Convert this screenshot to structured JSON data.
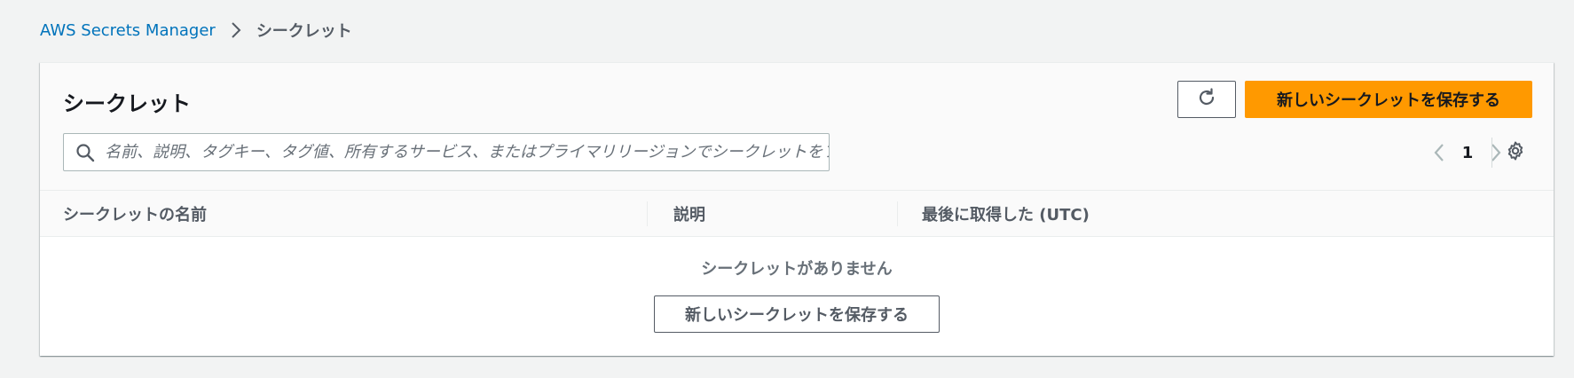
{
  "breadcrumb": {
    "root": "AWS Secrets Manager",
    "current": "シークレット"
  },
  "panel": {
    "title": "シークレット",
    "refresh_icon": "refresh-icon",
    "store_new_label": "新しいシークレットを保存する",
    "search_placeholder": "名前、説明、タグキー、タグ値、所有するサービス、またはプライマリリージョンでシークレットをフィルタリング",
    "pagination": {
      "current_page": "1"
    },
    "settings_icon": "gear-icon"
  },
  "table": {
    "columns": [
      "シークレットの名前",
      "説明",
      "最後に取得した (UTC)"
    ],
    "rows": [],
    "empty_message": "シークレットがありません",
    "empty_action_label": "新しいシークレットを保存する"
  },
  "colors": {
    "primary": "#ff9900",
    "link": "#0073bb",
    "background": "#f2f3f3"
  }
}
